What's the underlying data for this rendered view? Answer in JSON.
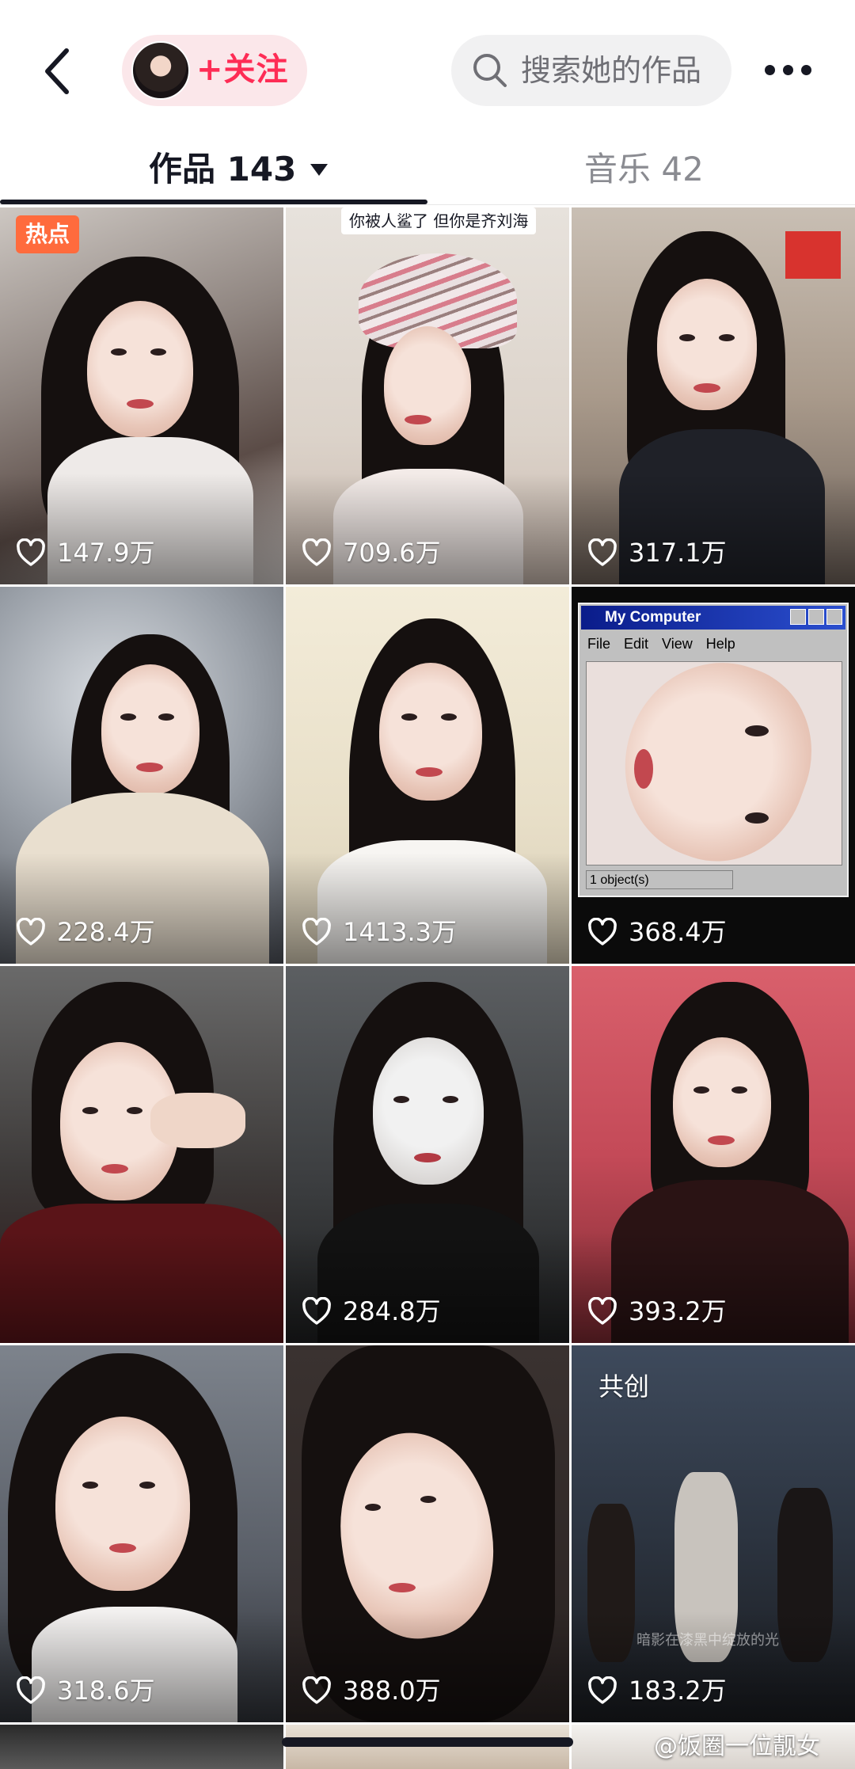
{
  "header": {
    "follow_label": "+关注",
    "search_placeholder": "搜索她的作品"
  },
  "tabs": {
    "works_label": "作品 143",
    "music_label": "音乐 42"
  },
  "grid": {
    "hot_badge": "热点",
    "caption_2": "你被人鲨了 但你是齐刘海",
    "window_title": "My Computer",
    "window_menu": "File Edit View Help",
    "window_status": "1 object(s)",
    "cocreate_badge": "共创",
    "overlay_12": "暗影在漆黑中绽放的光",
    "likes": [
      "147.9万",
      "709.6万",
      "317.1万",
      "228.4万",
      "1413.3万",
      "368.4万",
      "284.8万",
      "393.2万",
      "318.6万",
      "388.0万",
      "183.2万"
    ]
  },
  "watermark": "@饭圈一位靓女",
  "colors": {
    "accent": "#fe2c55",
    "hot": "#ff6b3d",
    "text": "#161823"
  }
}
